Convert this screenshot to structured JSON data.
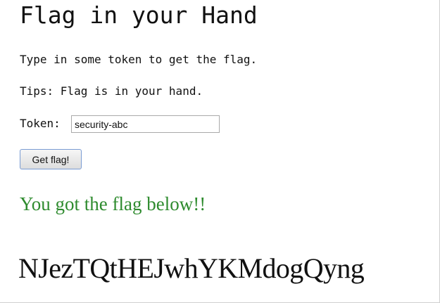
{
  "page": {
    "title": "Flag in your Hand",
    "instruction": "Type in some token to get the flag.",
    "tips": "Tips: Flag is in your hand."
  },
  "form": {
    "token_label": "Token:",
    "token_value": "security-abc",
    "submit_label": "Get flag!"
  },
  "result": {
    "message": "You got the flag below!!",
    "flag": "NJezTQtHEJwhYKMdogQyng",
    "message_color": "#2e8b2e"
  }
}
